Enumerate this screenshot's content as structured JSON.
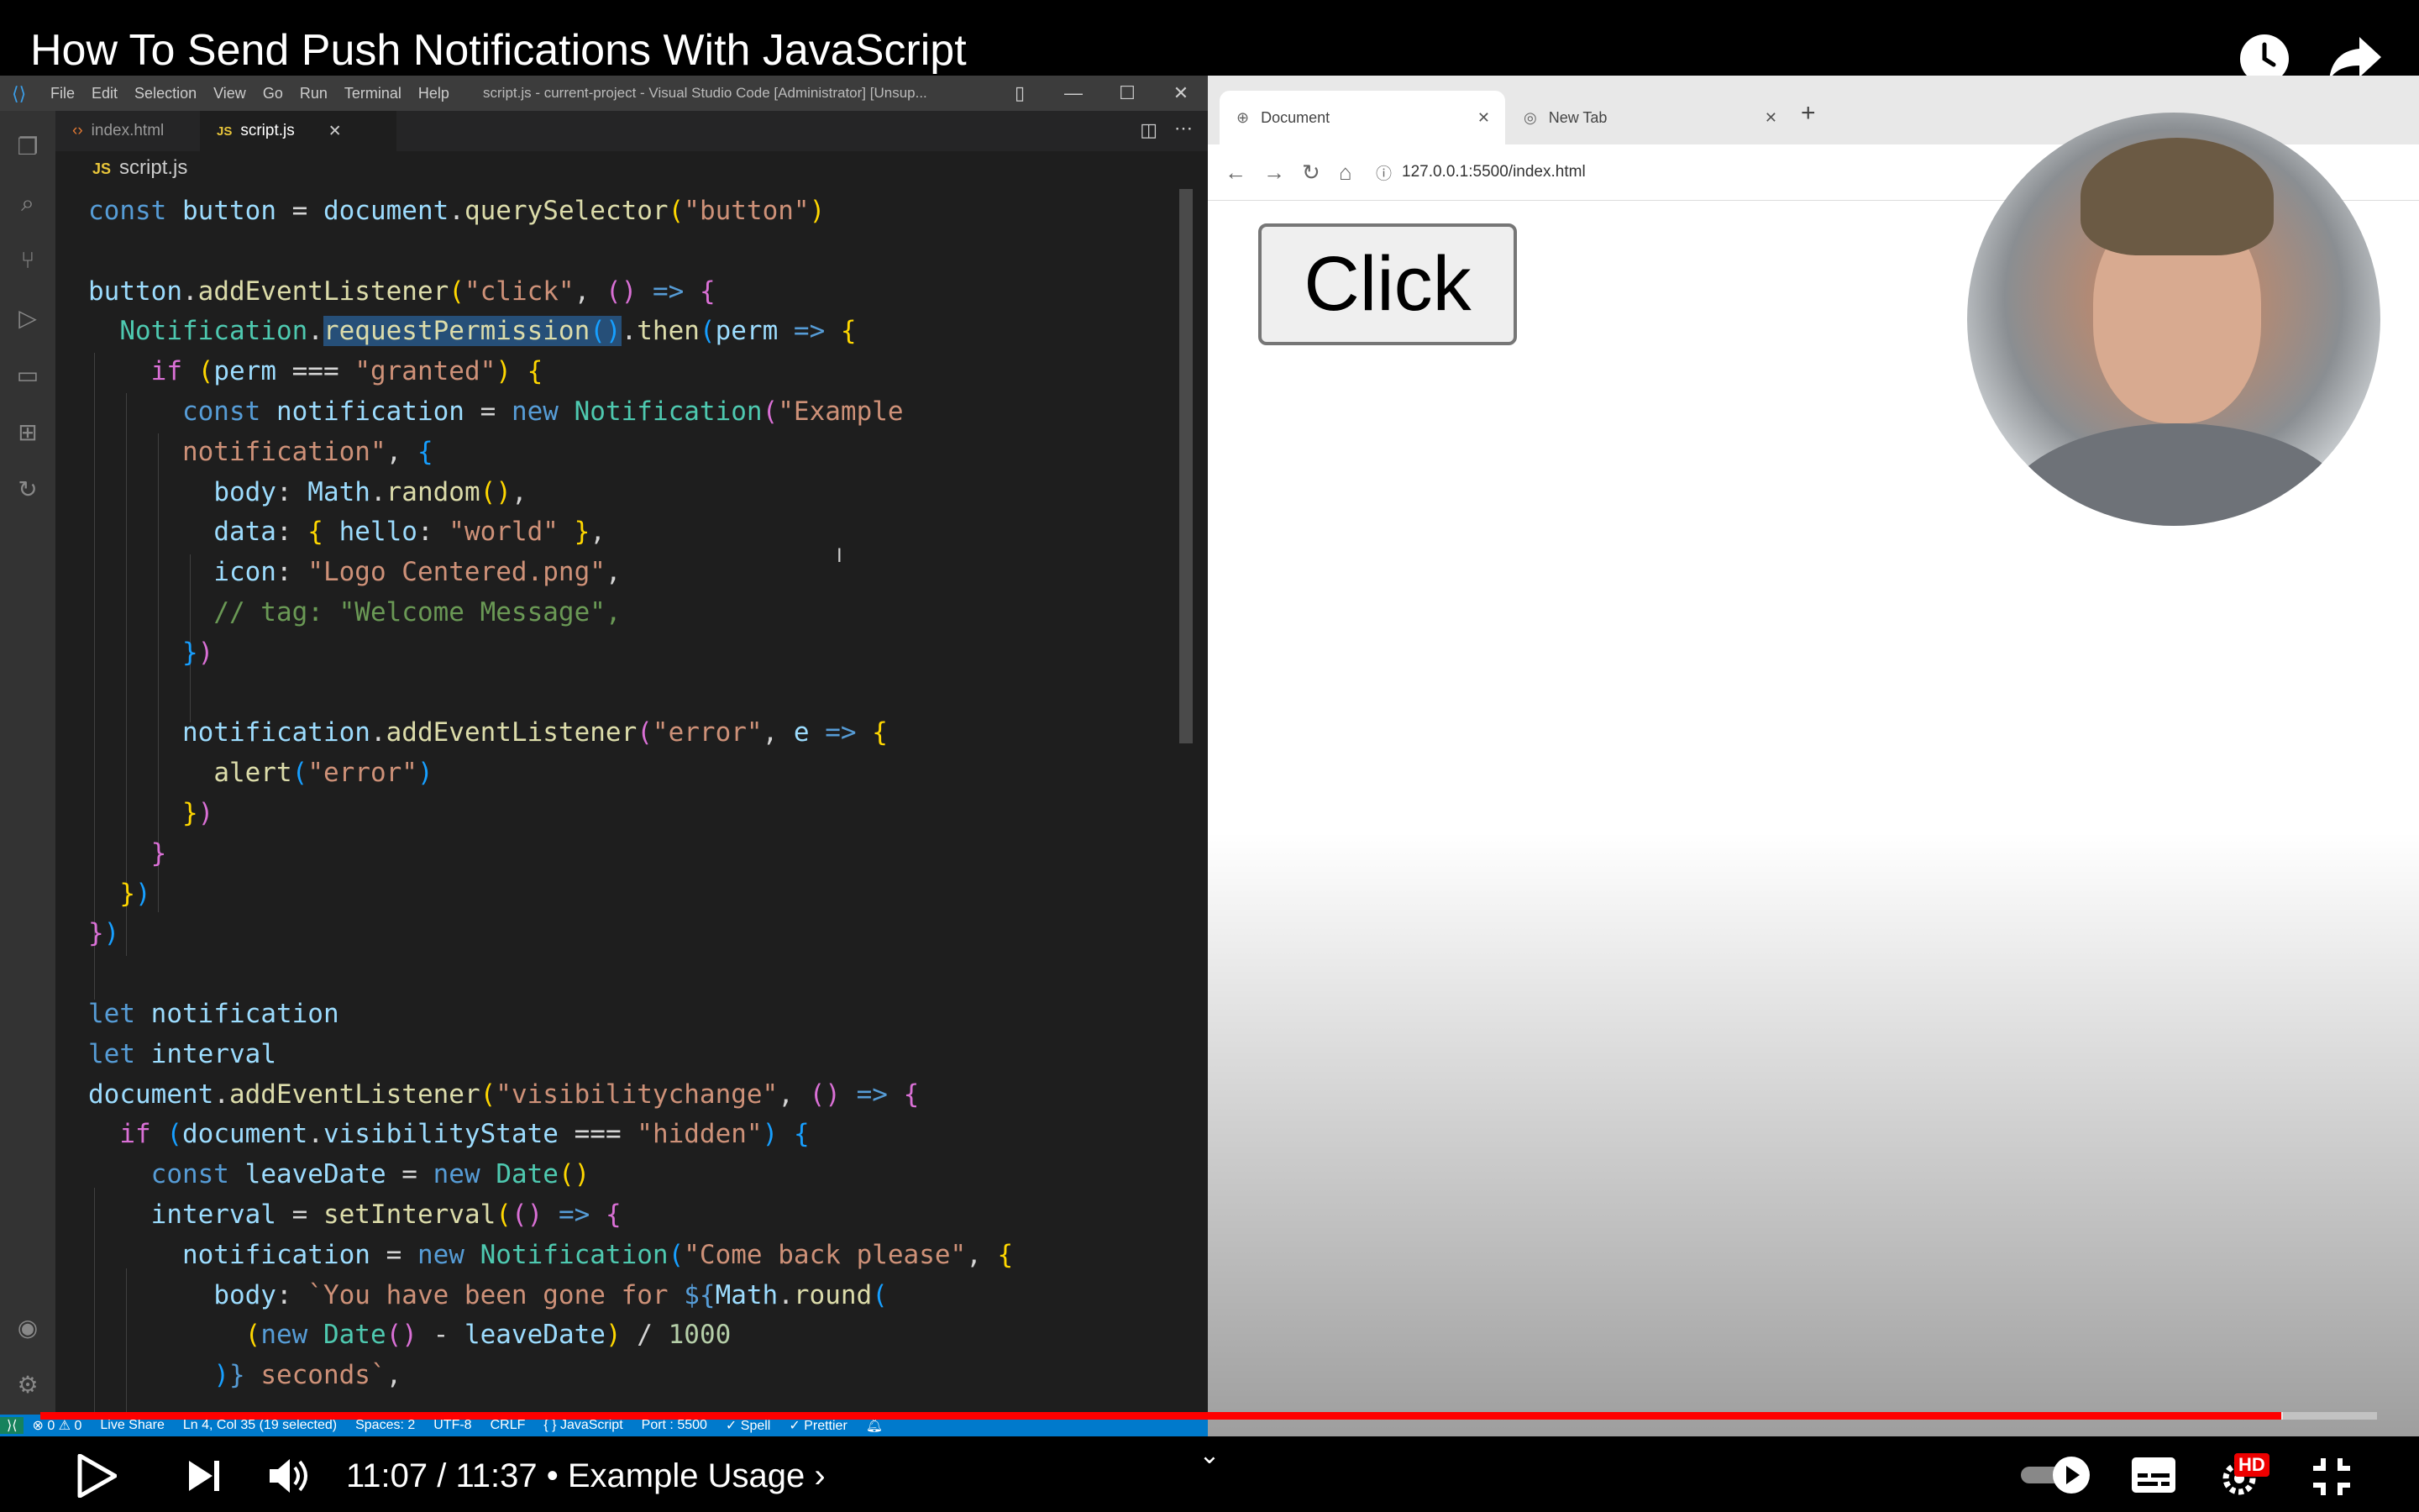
{
  "video": {
    "title": "How To Send Push Notifications With JavaScript",
    "current_time": "11:07",
    "duration": "11:37",
    "chapter": "Example Usage",
    "progress_fraction": 0.959,
    "quality_badge": "HD"
  },
  "vscode": {
    "menu": [
      "File",
      "Edit",
      "Selection",
      "View",
      "Go",
      "Run",
      "Terminal",
      "Help"
    ],
    "window_title": "script.js - current-project - Visual Studio Code [Administrator] [Unsup...",
    "tabs": [
      {
        "label": "index.html",
        "icon": "html-file-icon"
      },
      {
        "label": "script.js",
        "icon": "js-file-icon"
      }
    ],
    "breadcrumb": "script.js",
    "breadcrumb_icon": "JS",
    "code_lines": [
      "const button = document.querySelector(\"button\")",
      "",
      "button.addEventListener(\"click\", () => {",
      "  Notification.requestPermission().then(perm => {",
      "    if (perm === \"granted\") {",
      "      const notification = new Notification(\"Example",
      "      notification\", {",
      "        body: Math.random(),",
      "        data: { hello: \"world\" },",
      "        icon: \"Logo Centered.png\",",
      "        // tag: \"Welcome Message\",",
      "      })",
      "",
      "      notification.addEventListener(\"error\", e => {",
      "        alert(\"error\")",
      "      })",
      "    }",
      "  })",
      "})",
      "",
      "let notification",
      "let interval",
      "document.addEventListener(\"visibilitychange\", () => {",
      "  if (document.visibilityState === \"hidden\") {",
      "    const leaveDate = new Date()",
      "    interval = setInterval(() => {",
      "      notification = new Notification(\"Come back please\", {",
      "        body: `You have been gone for ${Math.round(",
      "          (new Date() - leaveDate) / 1000",
      "        )} seconds`,"
    ],
    "status": {
      "errors": "⊗ 0 ⚠ 0",
      "live_share": "Live Share",
      "position": "Ln 4, Col 35 (19 selected)",
      "spaces": "Spaces: 2",
      "encoding": "UTF-8",
      "eol": "CRLF",
      "language": "{ } JavaScript",
      "port": "Port : 5500",
      "spell": "✓ Spell",
      "prettier": "✓ Prettier"
    }
  },
  "browser": {
    "tabs": [
      {
        "label": "Document",
        "active": true
      },
      {
        "label": "New Tab",
        "active": false
      }
    ],
    "url": "127.0.0.1:5500/index.html",
    "page_button_label": "Click"
  }
}
